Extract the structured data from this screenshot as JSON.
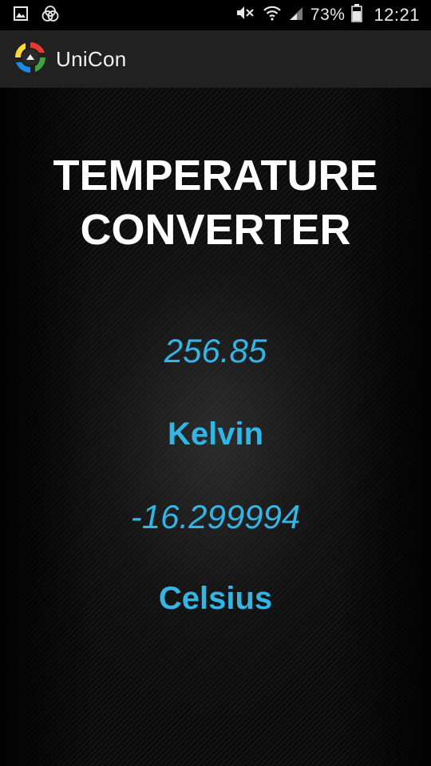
{
  "status_bar": {
    "battery_percent": "73%",
    "time": "12:21",
    "left_icons": [
      "gallery-icon",
      "aperture-icon"
    ],
    "right_icons": [
      "mute-icon",
      "wifi-icon",
      "signal-icon",
      "battery-icon"
    ],
    "battery_level": 0.73
  },
  "app_bar": {
    "title": "UniCon",
    "logo_icon": "unicon-logo-icon"
  },
  "converter": {
    "title_line1": "TEMPERATURE",
    "title_line2": "CONVERTER",
    "input_value": "256.85",
    "input_unit": "Kelvin",
    "output_value": "-16.299994",
    "output_unit": "Celsius"
  },
  "colors": {
    "accent": "#33b5e5",
    "app_bar_bg": "#212121",
    "title_text": "#ffffff"
  }
}
